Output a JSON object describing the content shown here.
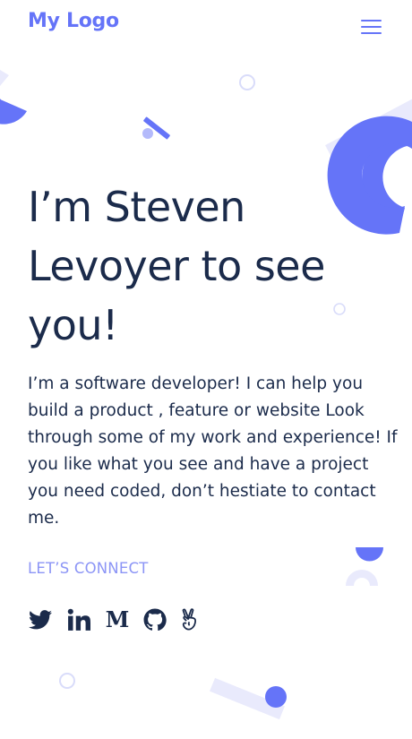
{
  "header": {
    "logo_text": "My Logo",
    "menu_icon": "hamburger-menu-icon"
  },
  "hero": {
    "title": "I’m Steven Levoyer to see you!",
    "description": "I’m a software developer! I can help you build a product , feature or website Look through some of my work and experience! If you like what you see and have a project you need coded, don’t hestiate to contact me.",
    "connect_label": "LET’S CONNECT"
  },
  "social_links": [
    {
      "name": "Twitter",
      "icon": "twitter-icon"
    },
    {
      "name": "LinkedIn",
      "icon": "linkedin-icon"
    },
    {
      "name": "Medium",
      "icon": "medium-icon",
      "glyph": "M"
    },
    {
      "name": "GitHub",
      "icon": "github-icon"
    },
    {
      "name": "AngelList",
      "icon": "angellist-icon"
    }
  ],
  "colors": {
    "accent": "#6574f8",
    "accent_light": "#8c95f6",
    "pale": "#e9eafc",
    "text": "#1b2b4b"
  }
}
